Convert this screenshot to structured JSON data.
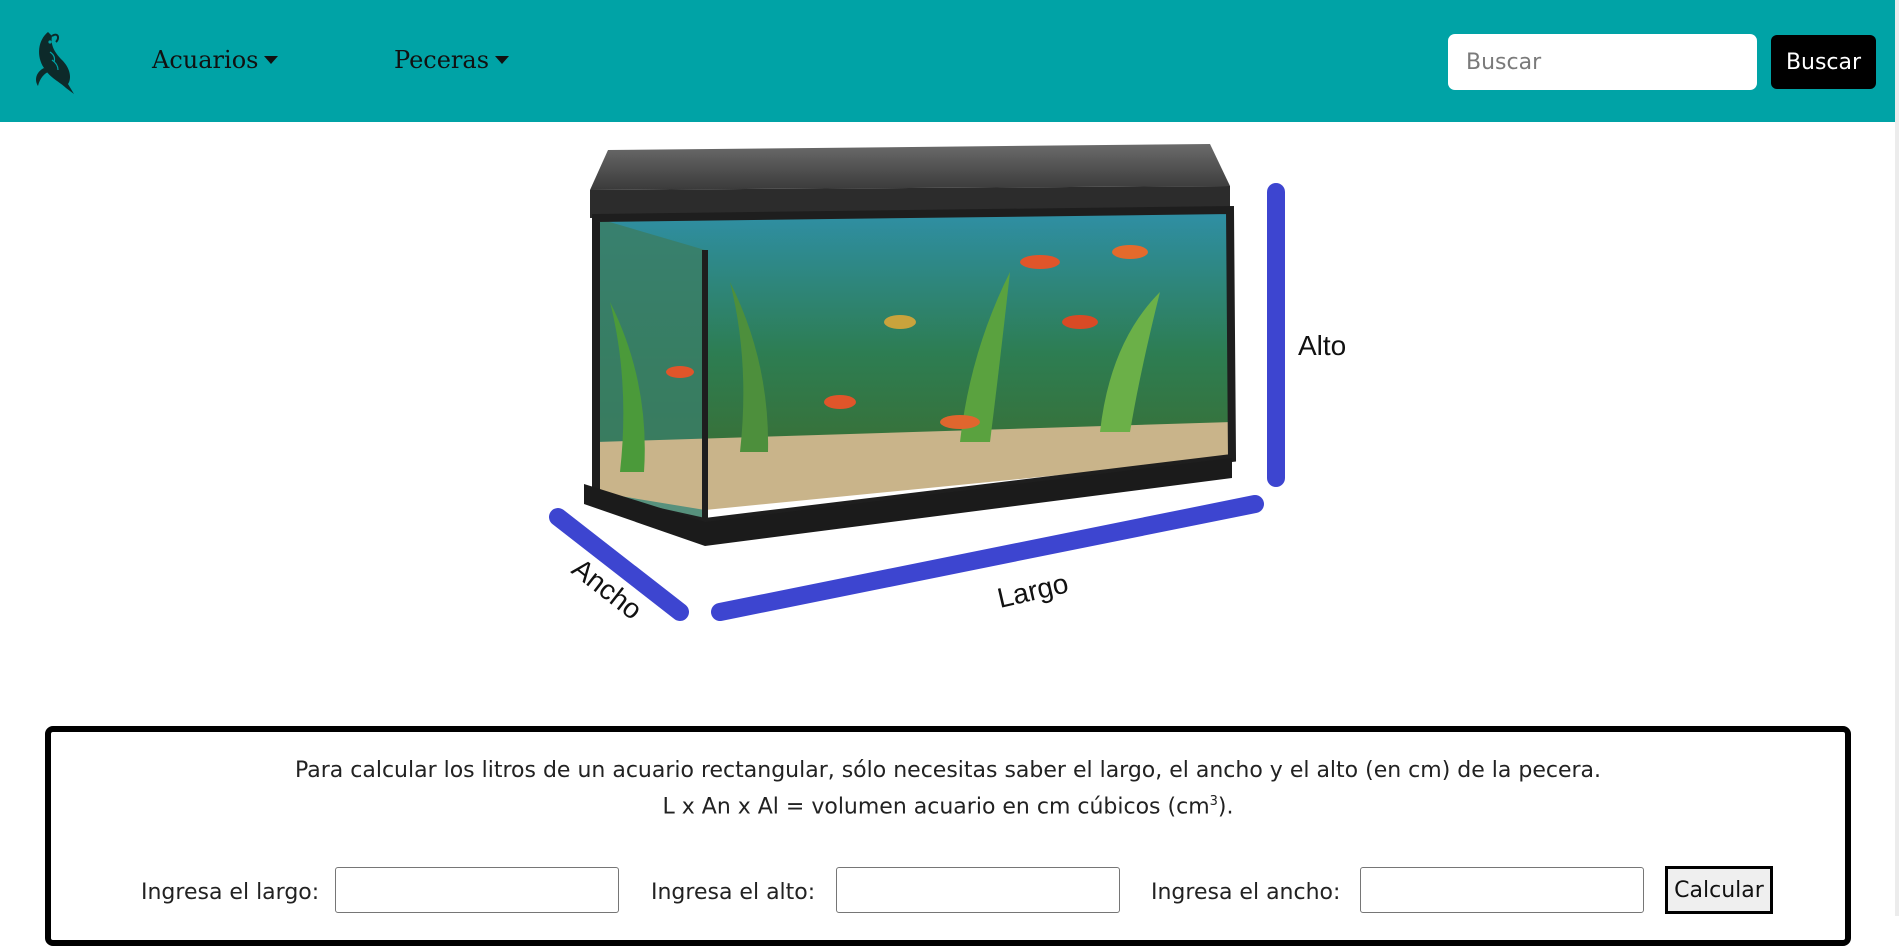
{
  "navbar": {
    "logo_icon": "koi-fish-logo-icon",
    "menu": [
      {
        "label": "Acuarios"
      },
      {
        "label": "Peceras"
      }
    ],
    "search": {
      "placeholder": "Buscar",
      "value": "",
      "button_label": "Buscar"
    },
    "background_color": "#00a3a6"
  },
  "hero": {
    "image": "aquarium-tank-image",
    "labels": {
      "height": "Alto",
      "length": "Largo",
      "width": "Ancho"
    },
    "dimension_line_color": "#3d45d0"
  },
  "calculator": {
    "intro": "Para calcular los litros de un acuario rectangular, sólo necesitas saber el largo, el ancho y el alto (en cm) de la pecera.",
    "formula": "L x An x Al = volumen acuario en cm cúbicos (cm",
    "formula_superscript": "3",
    "formula_suffix": ").",
    "fields": [
      {
        "label": "Ingresa el largo:",
        "value": ""
      },
      {
        "label": "Ingresa el alto:",
        "value": ""
      },
      {
        "label": "Ingresa el ancho:",
        "value": ""
      }
    ],
    "button_label": "Calcular"
  }
}
